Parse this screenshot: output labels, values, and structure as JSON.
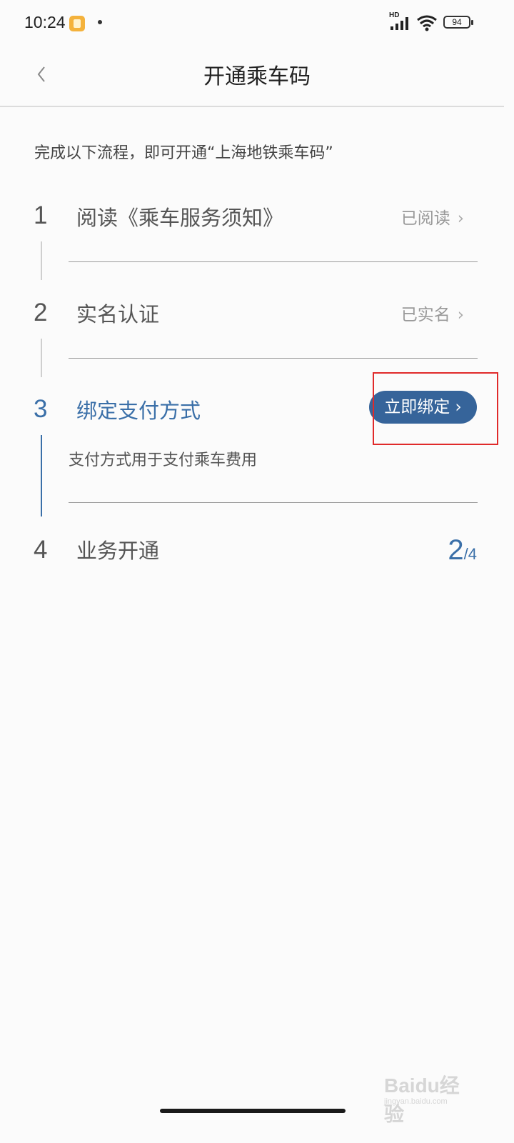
{
  "status_bar": {
    "time": "10:24",
    "network": "HD",
    "battery": "94"
  },
  "header": {
    "title": "开通乘车码"
  },
  "intro": "完成以下流程，即可开通“上海地铁乘车码”",
  "steps": [
    {
      "number": "1",
      "title": "阅读《乘车服务须知》",
      "status": "已阅读",
      "state": "done"
    },
    {
      "number": "2",
      "title": "实名认证",
      "status": "已实名",
      "state": "done"
    },
    {
      "number": "3",
      "title": "绑定支付方式",
      "action": "立即绑定",
      "description": "支付方式用于支付乘车费用",
      "state": "active"
    },
    {
      "number": "4",
      "title": "业务开通",
      "state": "pending"
    }
  ],
  "progress": {
    "current": "2",
    "total": "/4"
  },
  "colors": {
    "accent": "#3a6fa8",
    "button": "#36649a",
    "highlight": "#e02a2a"
  },
  "watermark": {
    "logo": "Baidu经验",
    "url": "jingyan.baidu.com"
  }
}
